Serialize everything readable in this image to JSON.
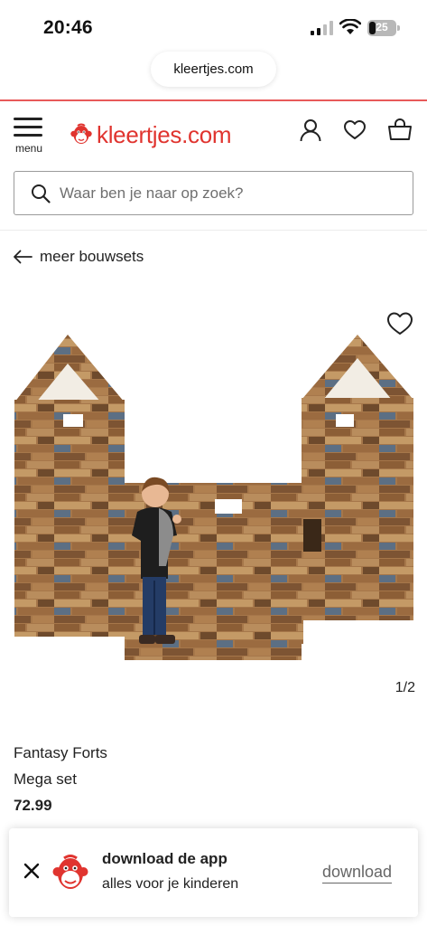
{
  "status_bar": {
    "time": "20:46",
    "battery_text": "25",
    "battery_level": 0.25,
    "icons": [
      "signal-icon",
      "wifi-icon",
      "battery-icon"
    ]
  },
  "browser": {
    "url": "kleertjes.com",
    "accent_color": "#e85a5a"
  },
  "header": {
    "menu_label": "menu",
    "logo_text": "kleertjes.com",
    "brand_color": "#e0342f",
    "icons": [
      "account-icon",
      "heart-icon",
      "shopping-bag-icon"
    ]
  },
  "search": {
    "placeholder": "Waar ben je naar op zoek?"
  },
  "breadcrumb": {
    "back_label": "meer bouwsets"
  },
  "product": {
    "image_counter": "1/2",
    "brand": "Fantasy Forts",
    "name": "Mega set",
    "price": "72.99"
  },
  "app_banner": {
    "title": "download de app",
    "subtitle": "alles voor je kinderen",
    "download_label": "download"
  }
}
